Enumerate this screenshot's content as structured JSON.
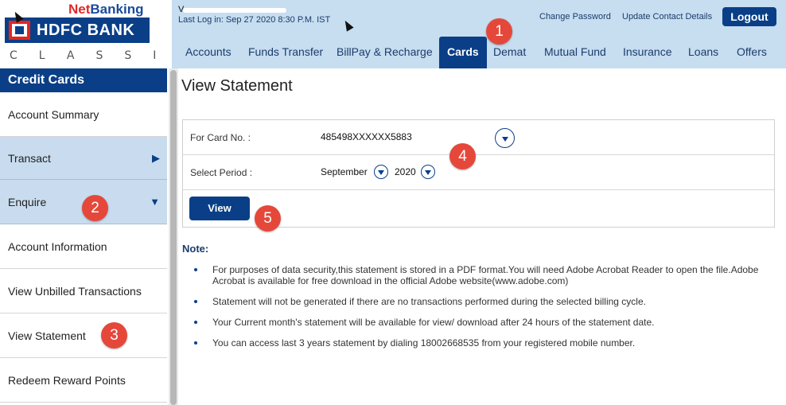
{
  "logo": {
    "net": "Net",
    "banking": "Banking",
    "bank_name": "HDFC BANK",
    "tagline": "CLASSIC",
    "colors": {
      "brand_blue": "#0a3f87",
      "brand_red": "#e3261f"
    }
  },
  "header": {
    "user_name": "V",
    "last_login": "Last Log in: Sep 27 2020 8:30 P.M. IST",
    "change_password": "Change Password",
    "update_contact": "Update Contact Details",
    "logout": "Logout",
    "nav_tabs": [
      {
        "label": "Accounts"
      },
      {
        "label": "Funds Transfer"
      },
      {
        "label": "BillPay & Recharge"
      },
      {
        "label": "Cards",
        "active": true
      },
      {
        "label": "Demat"
      },
      {
        "label": "Mutual Fund"
      },
      {
        "label": "Insurance"
      },
      {
        "label": "Loans"
      },
      {
        "label": "Offers"
      }
    ]
  },
  "sidebar": {
    "heading": "Credit Cards",
    "items": [
      {
        "label": "Account Summary"
      },
      {
        "label": "Transact",
        "icon": "triangle-right-icon"
      },
      {
        "label": "Enquire",
        "icon": "triangle-down-icon"
      },
      {
        "label": "Account Information"
      },
      {
        "label": "View Unbilled Transactions"
      },
      {
        "label": "View Statement"
      },
      {
        "label": "Redeem Reward Points"
      }
    ]
  },
  "main": {
    "title": "View Statement",
    "card_label": "For Card No. :",
    "card_value": "485498XXXXXX5883",
    "period_label": "Select Period :",
    "period_month": "September",
    "period_year": "2020",
    "view_button": "View",
    "note_title": "Note:",
    "notes": [
      "For purposes of data security,this statement is stored in a PDF format.You will need Adobe Acrobat Reader to open the file.Adobe Acrobat is available for free download in the official Adobe website(www.adobe.com)",
      "Statement will not be generated if there are no transactions performed during the selected billing cycle.",
      "Your Current month's statement will be available for view/ download after 24 hours of the statement date.",
      "You can access last 3 years statement by dialing 18002668535 from your registered mobile number."
    ]
  },
  "callouts": [
    "1",
    "2",
    "3",
    "4",
    "5"
  ]
}
